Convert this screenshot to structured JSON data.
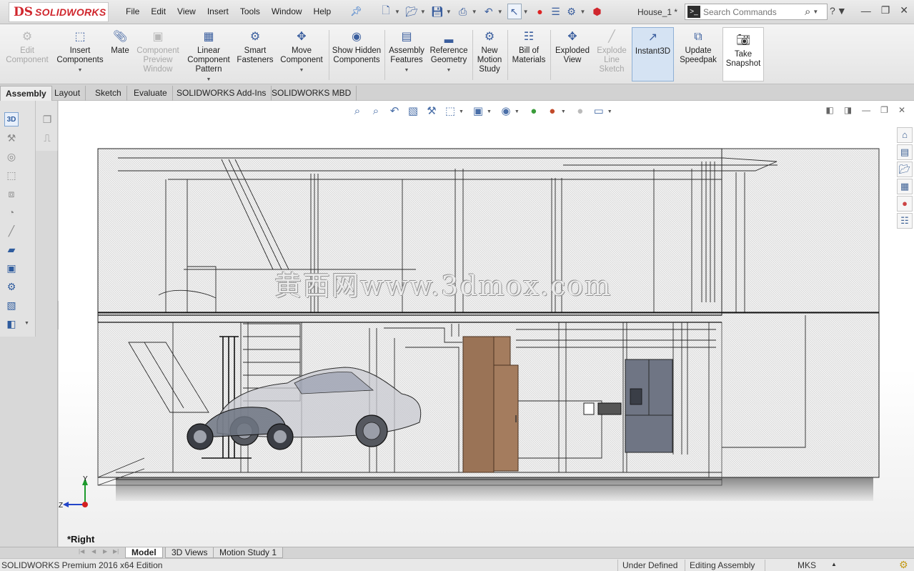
{
  "app": {
    "logo_ds": "DS",
    "logo_name": "SOLIDWORKS",
    "document_title": "House_1 *"
  },
  "menu": [
    "File",
    "Edit",
    "View",
    "Insert",
    "Tools",
    "Window",
    "Help"
  ],
  "search": {
    "placeholder": "Search Commands"
  },
  "commands": {
    "edit_component": "Edit Component",
    "insert_components": "Insert Components",
    "mate": "Mate",
    "component_preview_window": "Component Preview Window",
    "linear_component_pattern": "Linear Component Pattern",
    "smart_fasteners": "Smart Fasteners",
    "move_component": "Move Component",
    "show_hidden_components": "Show Hidden Components",
    "assembly_features": "Assembly Features",
    "reference_geometry": "Reference Geometry",
    "new_motion_study": "New Motion Study",
    "bill_of_materials": "Bill of Materials",
    "exploded_view": "Exploded View",
    "explode_line_sketch": "Explode Line Sketch",
    "instant3d": "Instant3D",
    "update_speedpak": "Update Speedpak",
    "take_snapshot": "Take Snapshot"
  },
  "tabs": [
    "Assembly",
    "Layout",
    "Sketch",
    "Evaluate",
    "SOLIDWORKS Add-Ins",
    "SOLIDWORKS MBD"
  ],
  "viewport": {
    "watermark": "黄西网www.3dmox.com",
    "view_label": "*Right",
    "triad_y": "Y",
    "triad_z": "Z"
  },
  "bottom_tabs": [
    "Model",
    "3D Views",
    "Motion Study 1"
  ],
  "status": {
    "edition": "SOLIDWORKS Premium 2016 x64 Edition",
    "defined_state": "Under Defined",
    "edit_mode": "Editing Assembly",
    "units": "MKS",
    "units_arrow": "▲"
  },
  "colors": {
    "brand_red": "#d0262d",
    "icon_blue": "#3a5e9e",
    "wood": "#9a7356",
    "fridge": "#6f7584",
    "wire": "#1f1f1f"
  }
}
